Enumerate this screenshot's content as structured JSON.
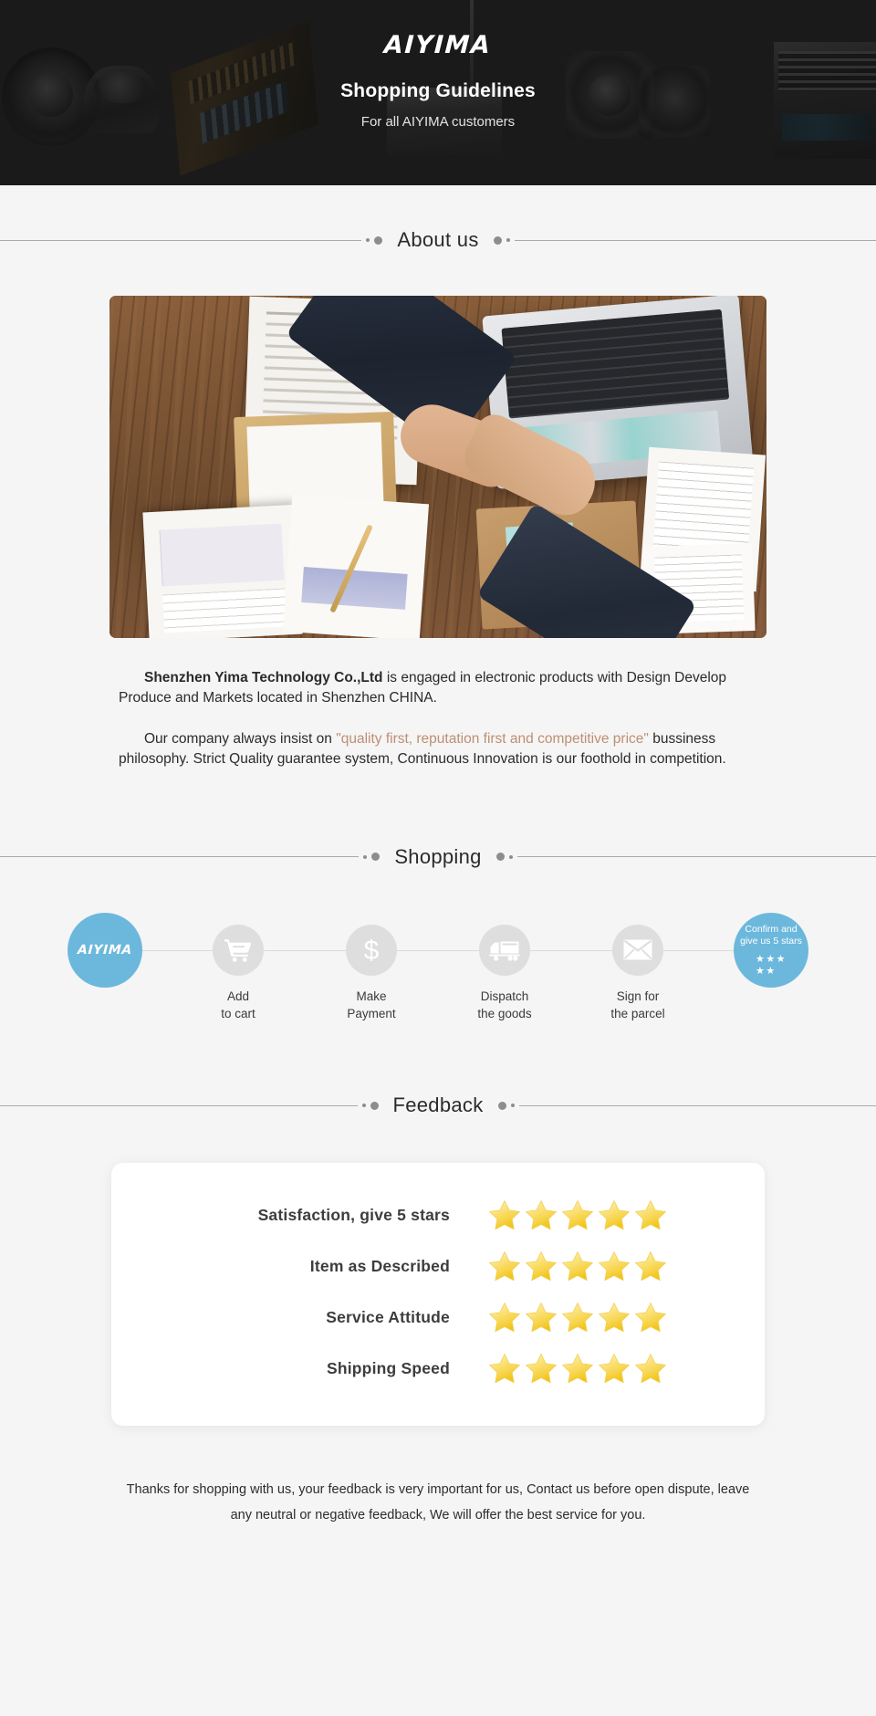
{
  "banner": {
    "logo": "AIYIMA",
    "title": "Shopping Guidelines",
    "subtitle": "For all AIYIMA customers"
  },
  "sections": {
    "about_title": "About us",
    "shopping_title": "Shopping",
    "feedback_title": "Feedback"
  },
  "about": {
    "p1_bold": "Shenzhen Yima Technology Co.,Ltd",
    "p1_rest": " is engaged in electronic products with Design Develop Produce and Markets located in Shenzhen CHINA.",
    "p2_pre": "Our company always insist on ",
    "p2_quote": "\"quality first, reputation first and competitive price\"",
    "p2_post": " bussiness philosophy. Strict Quality guarantee system, Continuous Innovation is our foothold in competition."
  },
  "shopping": {
    "steps": [
      {
        "icon": "aiyima-logo-icon",
        "brand": "AIYIMA",
        "label": ""
      },
      {
        "icon": "shopping-cart-icon",
        "label": "Add\nto cart"
      },
      {
        "icon": "dollar-sign-icon",
        "label": "Make\nPayment"
      },
      {
        "icon": "delivery-truck-icon",
        "label": "Dispatch\nthe goods"
      },
      {
        "icon": "envelope-icon",
        "label": "Sign for\nthe parcel"
      },
      {
        "icon": "five-stars-icon",
        "confirm_text": "Confirm and\ngive us 5 stars",
        "stars_row1": "★★★",
        "stars_row2": "★★",
        "label": ""
      }
    ]
  },
  "feedback": {
    "rows": [
      {
        "label": "Satisfaction, give 5 stars",
        "stars": 5
      },
      {
        "label": "Item as Described",
        "stars": 5
      },
      {
        "label": "Service Attitude",
        "stars": 5
      },
      {
        "label": "Shipping Speed",
        "stars": 5
      }
    ]
  },
  "footer": {
    "note": "Thanks for shopping with us, your feedback is very important for us, Contact us before open dispute, leave any neutral or negative feedback, We will offer the best service for you."
  },
  "colors": {
    "accent_blue": "#6cb8dc",
    "highlight_tan": "#bd8f74",
    "circle_gray": "#dedede",
    "page_bg": "#f5f5f5",
    "banner_bg": "#1a1a1a",
    "star_gold": "#f7d44c"
  }
}
